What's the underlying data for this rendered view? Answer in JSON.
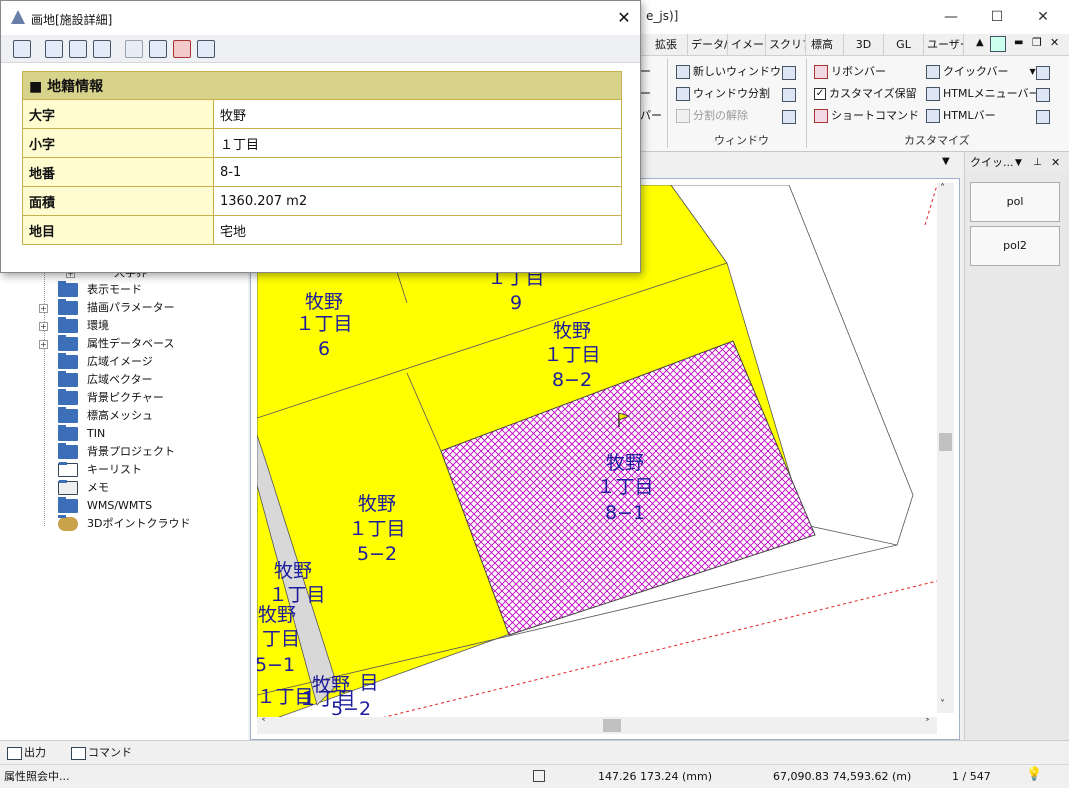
{
  "app": {
    "window_title": "e_js)]",
    "controls": {
      "minimize": "—",
      "maximize": "☐",
      "close": "✕"
    }
  },
  "ribbon": {
    "tabs": [
      "拡張",
      "データ/",
      "イメージ",
      "スクリプ",
      "標高",
      "3D",
      "GL",
      "ユーザー"
    ],
    "partial_labels": [
      "ー",
      "ー",
      "パー"
    ],
    "window_group": {
      "label": "ウィンドウ",
      "items": [
        "新しいウィンドウ",
        "ウィンドウ分割",
        "分割の解除"
      ]
    },
    "customize_group": {
      "label": "カスタマイズ",
      "items": [
        "リボンバー",
        "カスタマイズ保留",
        "ショートコマンド",
        "クイックバー",
        "HTMLメニューバー",
        "HTMLバー"
      ]
    }
  },
  "tree": {
    "partial_item": "大字界",
    "items": [
      "表示モード",
      "描画パラメーター",
      "環境",
      "属性データベース",
      "広域イメージ",
      "広域ベクター",
      "背景ピクチャー",
      "標高メッシュ",
      "TIN",
      "背景プロジェクト",
      "キーリスト",
      "メモ",
      "WMS/WMTS",
      "3Dポイントクラウド"
    ],
    "expand_marker": "+"
  },
  "map": {
    "parcels": [
      {
        "name": "牧野",
        "chome": "１丁目",
        "number": "6"
      },
      {
        "name": "牧野",
        "chome": "１丁目",
        "number": "9"
      },
      {
        "name": "牧野",
        "chome": "１丁目",
        "number": "8−2"
      },
      {
        "name": "牧野",
        "chome": "１丁目",
        "number": "8−1"
      },
      {
        "name": "牧野",
        "chome": "１丁目",
        "number": "5−2"
      },
      {
        "name": "牧野",
        "chome": "１丁目",
        "number": ""
      },
      {
        "name": "牧野",
        "chome": "丁目",
        "number": "5−1"
      }
    ],
    "overlap_labels": [
      "１丁目",
      "１丁目",
      "牧野",
      "5−2",
      "目"
    ],
    "colors": {
      "parcel": "#ffff00",
      "selected_hatch": "#c000c0",
      "label": "#1c1c9c",
      "boundary_red": "#e02020"
    }
  },
  "quickbar": {
    "title": "クイッ...",
    "buttons": [
      "pol",
      "pol2"
    ]
  },
  "bottom_tabs": [
    "出力",
    "コマンド"
  ],
  "status": {
    "message": "属性照会中...",
    "coords_mm": "147.26 173.24 (mm)",
    "coords_m": "67,090.83 74,593.62 (m)",
    "page": "1 / 547"
  },
  "dialog": {
    "title": "画地[施設詳細]",
    "close": "✕",
    "section_header": "■ 地籍情報",
    "rows": [
      {
        "key": "大字",
        "value": "牧野"
      },
      {
        "key": "小字",
        "value": "１丁目"
      },
      {
        "key": "地番",
        "value": "8-1"
      },
      {
        "key": "面積",
        "value": "1360.207 m2"
      },
      {
        "key": "地目",
        "value": "宅地"
      }
    ]
  }
}
